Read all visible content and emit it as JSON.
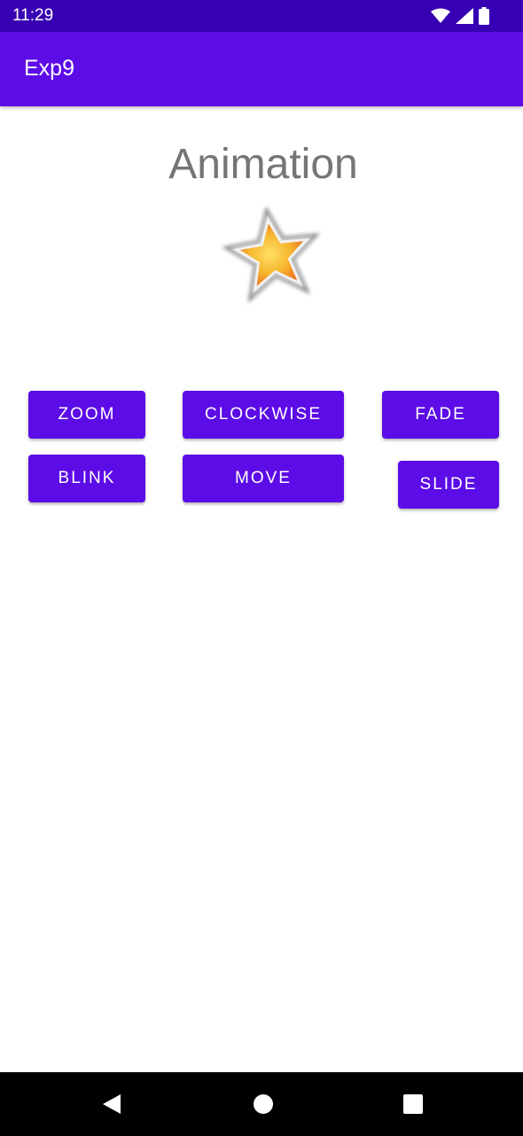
{
  "status_bar": {
    "time": "11:29",
    "icons": [
      "wifi-icon",
      "signal-icon",
      "battery-icon"
    ]
  },
  "app_bar": {
    "title": "Exp9",
    "color": "#5c0ce6"
  },
  "main": {
    "heading": "Animation",
    "image": "star-icon",
    "buttons": {
      "zoom": "ZOOM",
      "clockwise": "CLOCKWISE",
      "fade": "FADE",
      "blink": "BLINK",
      "move": "MOVE",
      "slide": "SLIDE"
    }
  },
  "nav_bar": {
    "icons": [
      "back-icon",
      "home-icon",
      "recents-icon"
    ]
  },
  "colors": {
    "status_bar": "#3700b3",
    "primary": "#5c0ce6",
    "heading_text": "#757575"
  }
}
